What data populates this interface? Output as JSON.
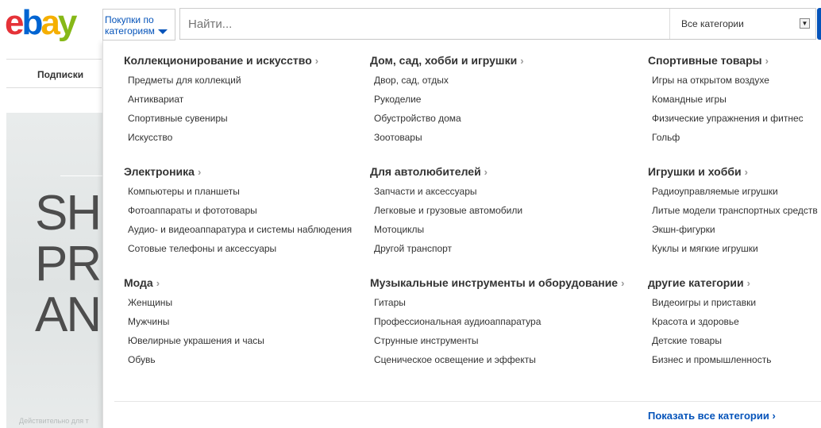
{
  "header": {
    "logo_letters": [
      "e",
      "b",
      "a",
      "y"
    ],
    "shop_by_category": "Покупки по категориям",
    "search_placeholder": "Найти...",
    "category_select": "Все категории"
  },
  "background": {
    "tab_subscriptions": "Подписки",
    "hero_lines": [
      "SH",
      "PR",
      "AN"
    ],
    "hero_note": "Действительно для т"
  },
  "menu": {
    "columns": [
      {
        "groups": [
          {
            "title": "Коллекционирование и искусство",
            "items": [
              "Предметы для коллекций",
              "Антиквариат",
              "Спортивные сувениры",
              "Искусство"
            ]
          },
          {
            "title": "Электроника",
            "items": [
              "Компьютеры и планшеты",
              "Фотоаппараты и фототовары",
              "Аудио- и видеоаппаратура и системы наблюдения",
              "Сотовые телефоны и аксессуары"
            ]
          },
          {
            "title": "Мода",
            "items": [
              "Женщины",
              "Мужчины",
              "Ювелирные украшения и часы",
              "Обувь"
            ]
          }
        ]
      },
      {
        "groups": [
          {
            "title": "Дом, сад, хобби и игрушки",
            "items": [
              "Двор, сад, отдых",
              "Рукоделие",
              "Обустройство дома",
              "Зоотовары"
            ]
          },
          {
            "title": "Для автолюбителей",
            "items": [
              "Запчасти и аксессуары",
              "Легковые и грузовые автомобили",
              "Мотоциклы",
              "Другой транспорт"
            ]
          },
          {
            "title": "Музыкальные инструменты и оборудование",
            "items": [
              "Гитары",
              "Профессиональная аудиоаппаратура",
              "Струнные инструменты",
              "Сценическое освещение и эффекты"
            ]
          }
        ]
      },
      {
        "groups": [
          {
            "title": "Спортивные товары",
            "items": [
              "Игры на открытом воздухе",
              "Командные игры",
              "Физические упражнения и фитнес",
              "Гольф"
            ]
          },
          {
            "title": "Игрушки и хобби",
            "items": [
              "Радиоуправляемые игрушки",
              "Литые модели транспортных средств",
              "Экшн-фигурки",
              "Куклы и мягкие игрушки"
            ]
          },
          {
            "title": "другие категории",
            "items": [
              "Видеоигры и приставки",
              "Красота и здоровье",
              "Детские товары",
              "Бизнес и промышленность"
            ]
          }
        ]
      }
    ],
    "show_all": "Показать все категории ›",
    "chevron": "›"
  },
  "colors": {
    "link_blue": "#0654ba",
    "logo": [
      "#e53238",
      "#0064d2",
      "#f5af02",
      "#86b817"
    ]
  }
}
